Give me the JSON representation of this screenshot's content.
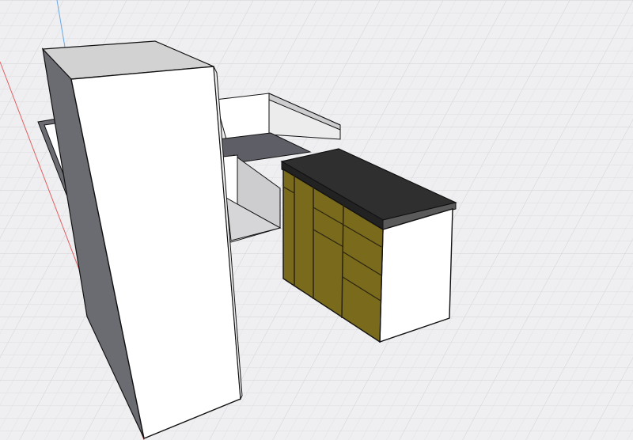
{
  "viewport": {
    "background": "#efeff1",
    "grid_color": "#d9d9de",
    "grid_major_color": "#cfcfd6",
    "axis_red": "#e06060",
    "axis_blue": "#6aa8e8"
  },
  "scene": {
    "objects": [
      "tall-wardrobe",
      "corner-cabinet-frame",
      "kitchen-island"
    ],
    "colors": {
      "white_face": "#ffffff",
      "top_face": "#d2d2d2",
      "dark_side": "#6b6b72",
      "inner_panel": "#cdcdcf",
      "inner_floor": "#5e5e66",
      "countertop": "#2f2f2f",
      "drawer_fronts": "#7a6a1c",
      "drawer_lines": "#2a2410",
      "edge": "#111111"
    }
  }
}
